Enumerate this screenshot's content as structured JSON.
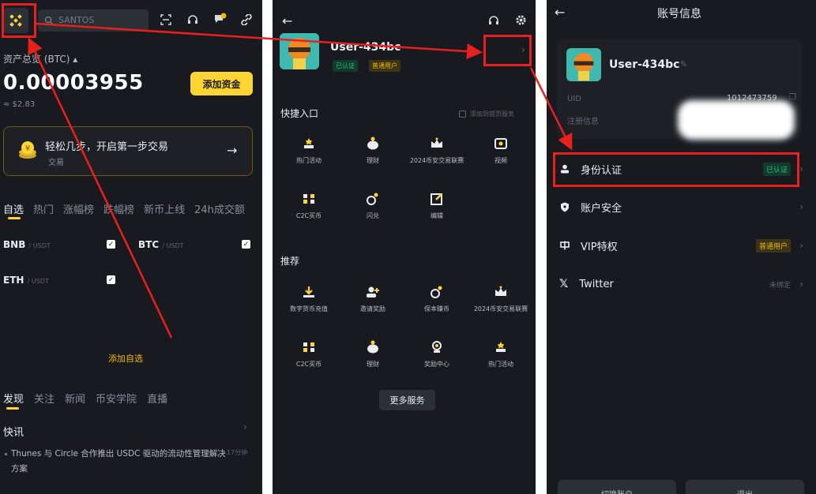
{
  "colors": {
    "bg": "#181a20",
    "accent": "#fcd535",
    "green": "#2ebd85",
    "annotation": "#e8201e"
  },
  "screen1": {
    "search_placeholder": "SANTOS",
    "asset_label": "资产总览 (BTC) ▴",
    "balance": "0.00003955",
    "balance_usd": "≈ $2.83",
    "add_funds": "添加资金",
    "promo": {
      "title": "轻松几步，开启第一步交易",
      "subtitle": "交易",
      "arrow": "→"
    },
    "market_tabs": [
      "自选",
      "热门",
      "涨幅榜",
      "跌幅榜",
      "新币上线",
      "24h成交额"
    ],
    "watchlist": [
      {
        "symbol": "BNB",
        "quote": "/ USDT"
      },
      {
        "symbol": "BTC",
        "quote": "/ USDT"
      },
      {
        "symbol": "ETH",
        "quote": "/ USDT"
      }
    ],
    "add_favorite": "添加自选",
    "feed_tabs": [
      "发现",
      "关注",
      "新闻",
      "币安学院",
      "直播"
    ],
    "news_header": "快讯",
    "news_text": "Thunes 与 Circle 合作推出 USDC 驱动的流动性管理解决方案",
    "news_time": "17分钟"
  },
  "screen2": {
    "username": "User-434bc",
    "tag_verified": "已认证",
    "tag_level": "普通用户",
    "quick_title": "快捷入口",
    "quick_hint": "添加到首页服务",
    "quick_items": [
      "热门活动",
      "理财",
      "2024币安交易联赛",
      "视频",
      "C2C买币",
      "闪兑",
      "编辑"
    ],
    "recommend_title": "推荐",
    "recommend_items": [
      "数字货币充值",
      "邀请奖励",
      "保本赚币",
      "2024币安交易联赛",
      "C2C买币",
      "理财",
      "奖励中心",
      "热门活动"
    ],
    "more_services": "更多服务"
  },
  "screen3": {
    "title": "账号信息",
    "username": "User-434bc",
    "uid_label": "UID",
    "uid_value": "1012473759",
    "reg_label": "注册信息",
    "rows": [
      {
        "label": "身份认证",
        "value": "已认证",
        "icon": "person-icon"
      },
      {
        "label": "账户安全",
        "value": "",
        "icon": "shield-icon"
      },
      {
        "label": "VIP特权",
        "value": "普通用户",
        "icon": "vip-icon"
      },
      {
        "label": "Twitter",
        "value": "未绑定",
        "icon": "x-icon"
      }
    ],
    "bottom_buttons": [
      "切换账户",
      "退出"
    ]
  }
}
